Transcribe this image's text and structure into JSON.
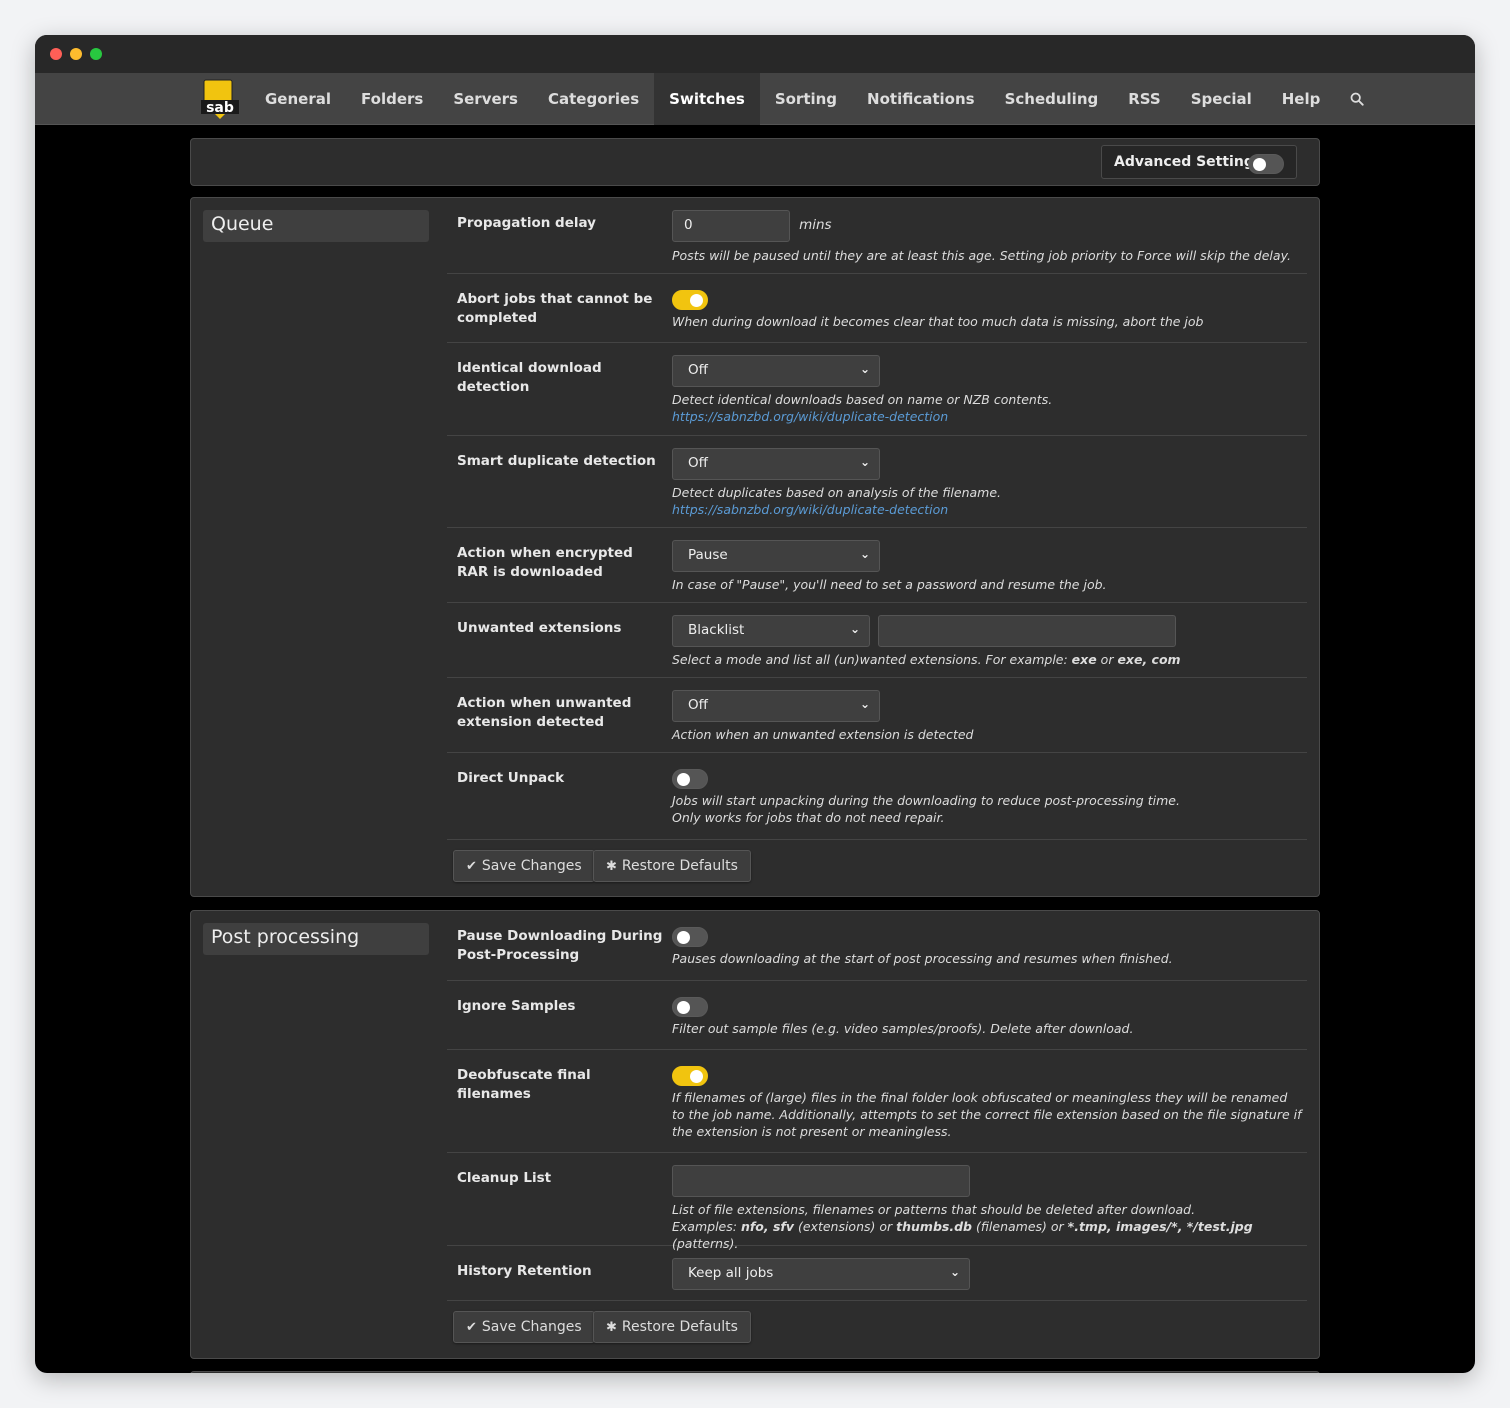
{
  "nav": {
    "logo_text": "sab",
    "items": [
      "General",
      "Folders",
      "Servers",
      "Categories",
      "Switches",
      "Sorting",
      "Notifications",
      "Scheduling",
      "RSS",
      "Special",
      "Help"
    ],
    "active": "Switches",
    "search_icon": "search-icon"
  },
  "advanced": {
    "label": "Advanced Settings",
    "enabled": false
  },
  "queue": {
    "title": "Queue",
    "propagation": {
      "label": "Propagation delay",
      "value": "0",
      "unit": "mins",
      "desc": "Posts will be paused until they are at least this age. Setting job priority to Force will skip the delay."
    },
    "abort": {
      "label": "Abort jobs that cannot be completed",
      "enabled": true,
      "desc": "When during download it becomes clear that too much data is missing, abort the job"
    },
    "identical": {
      "label": "Identical download detection",
      "value": "Off",
      "desc": "Detect identical downloads based on name or NZB contents.",
      "link": "https://sabnzbd.org/wiki/duplicate-detection"
    },
    "smart": {
      "label": "Smart duplicate detection",
      "value": "Off",
      "desc": "Detect duplicates based on analysis of the filename.",
      "link": "https://sabnzbd.org/wiki/duplicate-detection"
    },
    "encrypted": {
      "label": "Action when encrypted RAR is downloaded",
      "value": "Pause",
      "desc": "In case of \"Pause\", you'll need to set a password and resume the job."
    },
    "unwanted": {
      "label": "Unwanted extensions",
      "mode": "Blacklist",
      "list_value": "",
      "desc_pre": "Select a mode and list all (un)wanted extensions. For example: ",
      "ex1": "exe",
      "desc_mid": " or ",
      "ex2": "exe, com"
    },
    "unwanted_action": {
      "label": "Action when unwanted extension detected",
      "value": "Off",
      "desc": "Action when an unwanted extension is detected"
    },
    "direct_unpack": {
      "label": "Direct Unpack",
      "enabled": false,
      "desc1": "Jobs will start unpacking during the downloading to reduce post-processing time.",
      "desc2": "Only works for jobs that do not need repair."
    },
    "save_label": "Save Changes",
    "restore_label": "Restore Defaults"
  },
  "post": {
    "title": "Post processing",
    "pause_dl": {
      "label": "Pause Downloading During Post-Processing",
      "enabled": false,
      "desc": "Pauses downloading at the start of post processing and resumes when finished."
    },
    "ignore_samples": {
      "label": "Ignore Samples",
      "enabled": false,
      "desc": "Filter out sample files (e.g. video samples/proofs). Delete after download."
    },
    "deobfuscate": {
      "label": "Deobfuscate final filenames",
      "enabled": true,
      "desc": "If filenames of (large) files in the final folder look obfuscated or meaningless they will be renamed to the job name. Additionally, attempts to set the correct file extension based on the file signature if the extension is not present or meaningless."
    },
    "cleanup": {
      "label": "Cleanup List",
      "value": "",
      "desc1": "List of file extensions, filenames or patterns that should be deleted after download.",
      "ex_pre": "Examples: ",
      "ex1": "nfo, sfv",
      "ex_t1": " (extensions) or ",
      "ex2": "thumbs.db",
      "ex_t2": " (filenames) or ",
      "ex3": "*.tmp, images/*, */test.jpg",
      "ex_t3": " (patterns)."
    },
    "history": {
      "label": "History Retention",
      "value": "Keep all jobs"
    },
    "save_label": "Save Changes",
    "restore_label": "Restore Defaults"
  },
  "colors": {
    "accent": "#f1c40f",
    "link": "#5b9bd5",
    "panel": "#2d2d2d",
    "nav": "#444444"
  }
}
